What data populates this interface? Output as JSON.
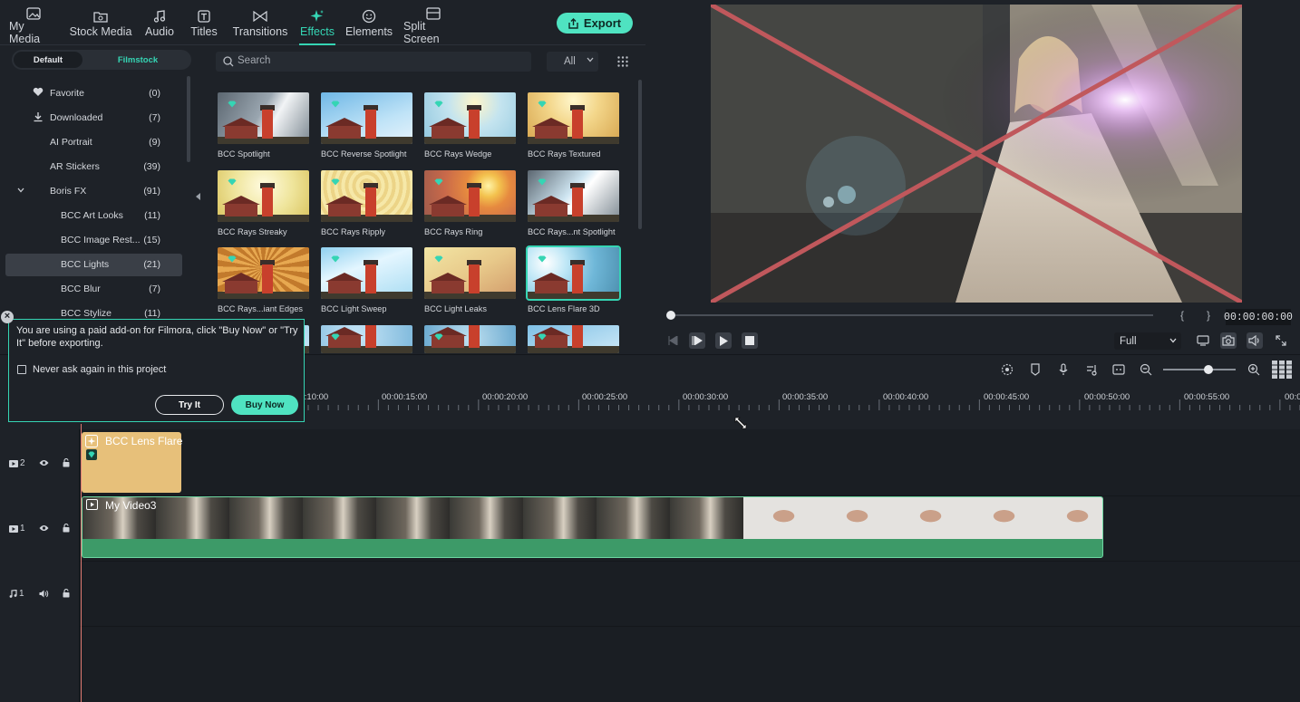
{
  "media_tabs": [
    {
      "label": "My Media",
      "icon": "image-icon"
    },
    {
      "label": "Stock Media",
      "icon": "folder-image-icon"
    },
    {
      "label": "Audio",
      "icon": "music-note-icon"
    },
    {
      "label": "Titles",
      "icon": "text-t-icon"
    },
    {
      "label": "Transitions",
      "icon": "transition-icon"
    },
    {
      "label": "Effects",
      "icon": "sparkle-icon",
      "active": true
    },
    {
      "label": "Elements",
      "icon": "elements-icon"
    },
    {
      "label": "Split Screen",
      "icon": "split-screen-icon"
    }
  ],
  "export_label": "Export",
  "segment": {
    "default_label": "Default",
    "filmstock_label": "Filmstock"
  },
  "tree": [
    {
      "label": "Favorite",
      "count": "(0)",
      "icon": "heart-icon"
    },
    {
      "label": "Downloaded",
      "count": "(7)",
      "icon": "download-icon"
    },
    {
      "label": "AI Portrait",
      "count": "(9)"
    },
    {
      "label": "AR Stickers",
      "count": "(39)"
    },
    {
      "label": "Boris FX",
      "count": "(91)",
      "expanded": true
    },
    {
      "label": "BCC Art Looks",
      "count": "(11)"
    },
    {
      "label": "BCC Image Rest...",
      "count": "(15)"
    },
    {
      "label": "BCC Lights",
      "count": "(21)",
      "selected": true
    },
    {
      "label": "BCC Blur",
      "count": "(7)"
    },
    {
      "label": "BCC Stylize",
      "count": "(11)"
    }
  ],
  "search": {
    "placeholder": "Search",
    "filter_value": "All"
  },
  "effects": [
    {
      "label": "BCC Spotlight"
    },
    {
      "label": "BCC Reverse Spotlight"
    },
    {
      "label": "BCC Rays Wedge"
    },
    {
      "label": "BCC Rays Textured"
    },
    {
      "label": "BCC Rays Streaky"
    },
    {
      "label": "BCC Rays Ripply"
    },
    {
      "label": "BCC Rays Ring"
    },
    {
      "label": "BCC Rays...nt Spotlight"
    },
    {
      "label": "BCC Rays...iant Edges"
    },
    {
      "label": "BCC Light Sweep"
    },
    {
      "label": "BCC Light Leaks"
    },
    {
      "label": "BCC Lens Flare 3D",
      "selected": true
    },
    {
      "label": ""
    },
    {
      "label": ""
    },
    {
      "label": ""
    },
    {
      "label": ""
    }
  ],
  "preview": {
    "brace_left": "{",
    "brace_right": "}",
    "timecode": "00:00:00:00",
    "quality": "Full",
    "progress": 0
  },
  "timeline": {
    "ruler_labels": [
      "00:00:10:00",
      "00:00:15:00",
      "00:00:20:00",
      "00:00:25:00",
      "00:00:30:00",
      "00:00:35:00",
      "00:00:40:00",
      "00:00:45:00",
      "00:00:50:00",
      "00:00:55:00",
      "00:0"
    ],
    "zoom_level": 0.6,
    "tracks": [
      {
        "label": "2",
        "kind": "video"
      },
      {
        "label": "1",
        "kind": "video"
      },
      {
        "label": "1",
        "kind": "audio"
      }
    ],
    "fx_clip_label": "BCC Lens Flare",
    "video_clip_label": "My Video3"
  },
  "dialog": {
    "message": "You are using a paid add-on for Filmora, click \"Buy Now\" or \"Try It\" before exporting.",
    "close": "×",
    "checkbox_label": "Never ask again in this project",
    "try_label": "Try It",
    "buy_label": "Buy Now"
  },
  "colors": {
    "accent": "#35d5b4",
    "export_bg": "#4fe3c1",
    "fx_clip": "#e7c07a",
    "video_clip": "#3d9a68",
    "playhead": "#e07a72"
  }
}
